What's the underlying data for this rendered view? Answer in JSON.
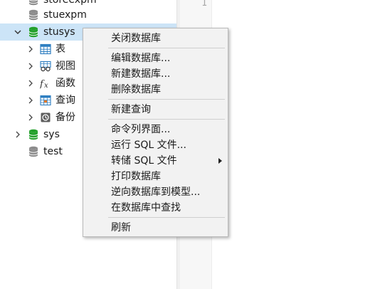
{
  "tree": {
    "items": [
      {
        "label": "storeexpm",
        "icon": "database-icon",
        "color": "#8c8c8c"
      },
      {
        "label": "stuexpm",
        "icon": "database-icon",
        "color": "#8c8c8c"
      },
      {
        "label": "stusys",
        "icon": "database-icon",
        "color": "#22a02a"
      },
      {
        "label": "表",
        "icon": "table-icon"
      },
      {
        "label": "视图",
        "icon": "view-icon"
      },
      {
        "label": "函数",
        "icon": "function-icon"
      },
      {
        "label": "查询",
        "icon": "query-icon"
      },
      {
        "label": "备份",
        "icon": "backup-icon"
      },
      {
        "label": "sys",
        "icon": "database-icon",
        "color": "#22a02a"
      },
      {
        "label": "test",
        "icon": "database-icon",
        "color": "#8c8c8c"
      }
    ]
  },
  "editor": {
    "line_number": "1"
  },
  "context_menu": {
    "close_database": "关闭数据库",
    "edit_database": "编辑数据库...",
    "new_database": "新建数据库...",
    "delete_database": "删除数据库",
    "new_query": "新建查询",
    "console": "命令列界面...",
    "run_sql_file": "运行 SQL 文件...",
    "dump_sql_file": "转储 SQL 文件",
    "print_database": "打印数据库",
    "reverse_to_model": "逆向数据库到模型...",
    "find_in_database": "在数据库中查找",
    "refresh": "刷新"
  },
  "colors": {
    "selection": "#cce4f7",
    "menu_bg": "#f2f2f2",
    "db_active": "#22a02a",
    "db_inactive": "#8c8c8c",
    "table_icon": "#2f7fc1"
  }
}
